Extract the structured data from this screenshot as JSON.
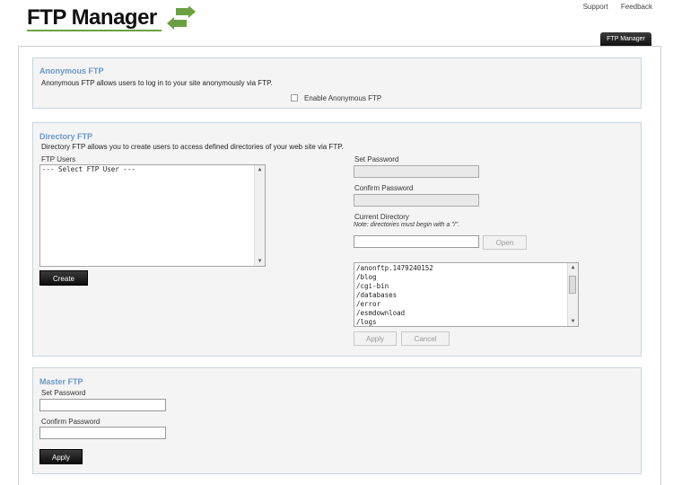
{
  "app": {
    "title": "FTP Manager"
  },
  "toplinks": {
    "support": "Support",
    "feedback": "Feedback"
  },
  "tab": {
    "label": "FTP Manager"
  },
  "colors": {
    "accent": "#6a98c7",
    "logo_green": "#6aa042"
  },
  "anonymous": {
    "title": "Anonymous FTP",
    "description": "Anonymous FTP allows users to log in to your site anonymously via FTP.",
    "checkbox_label": "Enable Anonymous FTP",
    "checked": false
  },
  "directory": {
    "title": "Directory FTP",
    "description": "Directory FTP allows you to create users to access defined directories of your web site via FTP.",
    "users_label": "FTP Users",
    "users": [
      "--- Select FTP User ---"
    ],
    "create_label": "Create",
    "set_password_label": "Set Password",
    "confirm_password_label": "Confirm Password",
    "current_dir_label": "Current Directory",
    "current_dir_note": "Note: directories must begin with a \"/\".",
    "open_label": "Open",
    "dirs": [
      "/anonftp.1479240152",
      "/blog",
      "/cgi-bin",
      "/databases",
      "/error",
      "/esmdownload",
      "/logs"
    ],
    "apply_label": "Apply",
    "cancel_label": "Cancel"
  },
  "master": {
    "title": "Master FTP",
    "set_password_label": "Set Password",
    "confirm_password_label": "Confirm Password",
    "apply_label": "Apply"
  }
}
